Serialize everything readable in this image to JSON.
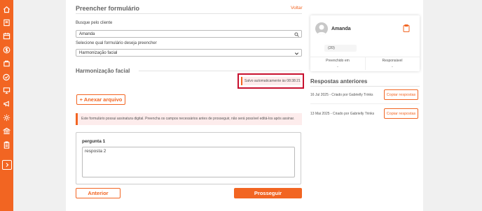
{
  "sidebar": {
    "icons": [
      "home-icon",
      "book-icon",
      "calendar-icon",
      "dollar-icon",
      "bag-icon",
      "check-circle-icon",
      "presentation-icon",
      "megaphone-icon",
      "gear-icon",
      "bank-icon",
      "clipboard-icon"
    ],
    "expand_icon": "chevron-right-icon",
    "color": "#f26522"
  },
  "header": {
    "title": "Preencher formulário",
    "back_link": "Voltar"
  },
  "form": {
    "client_label": "Busque pelo cliente",
    "client_value": "Amanda",
    "form_select_label": "Selecione qual formulário deseja preencher",
    "form_select_value": "Harmonização facial"
  },
  "section": {
    "title": "Harmonização facial",
    "autosave": "Salvo automaticamente às 08:38:21",
    "attach_button": "+ Anexar arquivo",
    "alert": "Este formulário possui assinatura digital. Preencha os campos necessários antes de prosseguir, não será possível editá-los após assinar."
  },
  "question": {
    "label": "pergunta 1",
    "answer": "resposta 2"
  },
  "footer": {
    "prev_button": "Anterior",
    "next_button": "Prosseguir"
  },
  "client_card": {
    "name": "Amanda",
    "id_value": "(20)",
    "filled_label": "Preenchido em",
    "filled_value": "-",
    "responsible_label": "Responsável",
    "responsible_value": "-"
  },
  "previous_responses": {
    "title": "Respostas anteriores",
    "items": [
      {
        "text": "16 Jul 2025 - Criado por Gabrielly Trinks",
        "button": "Copiar respostas"
      },
      {
        "text": "13 Mai 2025 - Criado por Gabrielly Trinks",
        "button": "Copiar respostas"
      }
    ]
  },
  "colors": {
    "accent": "#f26522",
    "highlight_border": "#c8102e"
  }
}
